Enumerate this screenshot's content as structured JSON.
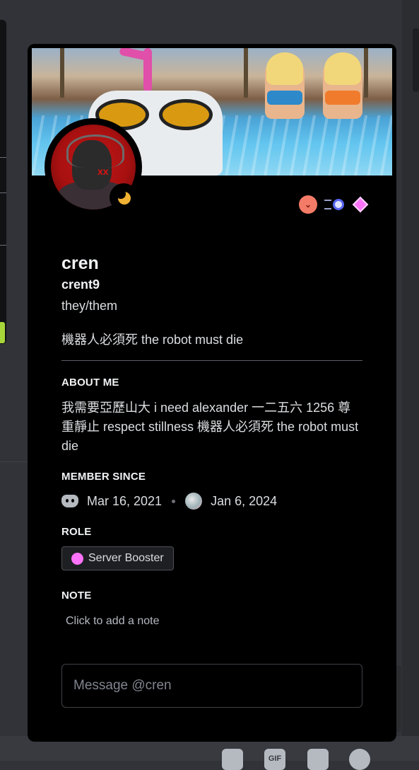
{
  "profile": {
    "display_name": "cren",
    "username": "crent9",
    "pronouns": "they/them",
    "custom_status": "機器人必須死 the robot must die",
    "status": "idle",
    "badges": [
      "hypesquad-icon",
      "speedrun-icon",
      "nitro-boost-icon"
    ]
  },
  "about": {
    "title": "ABOUT ME",
    "text": "我需要亞歷山大 i need alexander 一二五六 1256 尊重靜止 respect stillness 機器人必須死 the robot must die"
  },
  "member_since": {
    "title": "MEMBER SINCE",
    "discord_date": "Mar 16, 2021",
    "server_date": "Jan 6, 2024"
  },
  "role": {
    "title": "ROLE",
    "name": "Server Booster",
    "color": "#ff73fa"
  },
  "note": {
    "title": "NOTE",
    "placeholder": "Click to add a note"
  },
  "message": {
    "placeholder": "Message @cren"
  },
  "bottom_bar": {
    "gif_label": "GIF",
    "icons": [
      "gift-icon",
      "gif-icon",
      "sticker-icon",
      "emoji-icon"
    ]
  },
  "colors": {
    "card_bg": "#000000",
    "app_bg": "#313338",
    "idle": "#f0b232",
    "hype": "#f47b67"
  }
}
